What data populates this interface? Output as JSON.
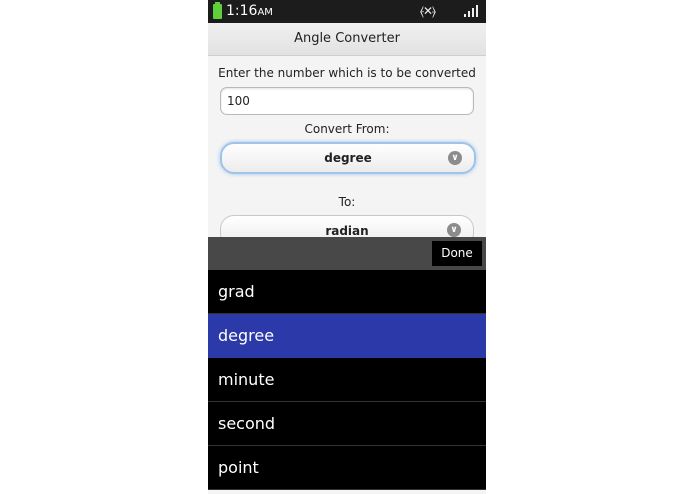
{
  "status_bar": {
    "time": "1:16",
    "ampm": "AM",
    "vibrate_glyph": "⦑✕⦒",
    "battery_color": "#5fcf3a"
  },
  "app": {
    "title": "Angle Converter"
  },
  "form": {
    "prompt": "Enter the number which is to be converted",
    "input_value": "100",
    "from_label": "Convert From:",
    "from_value": "degree",
    "to_label": "To:",
    "to_value": "radian"
  },
  "picker": {
    "done_label": "Done",
    "selected_color": "#2b3aa8",
    "items": [
      {
        "label": "grad",
        "selected": false
      },
      {
        "label": "degree",
        "selected": true
      },
      {
        "label": "minute",
        "selected": false
      },
      {
        "label": "second",
        "selected": false
      },
      {
        "label": "point",
        "selected": false
      }
    ]
  }
}
